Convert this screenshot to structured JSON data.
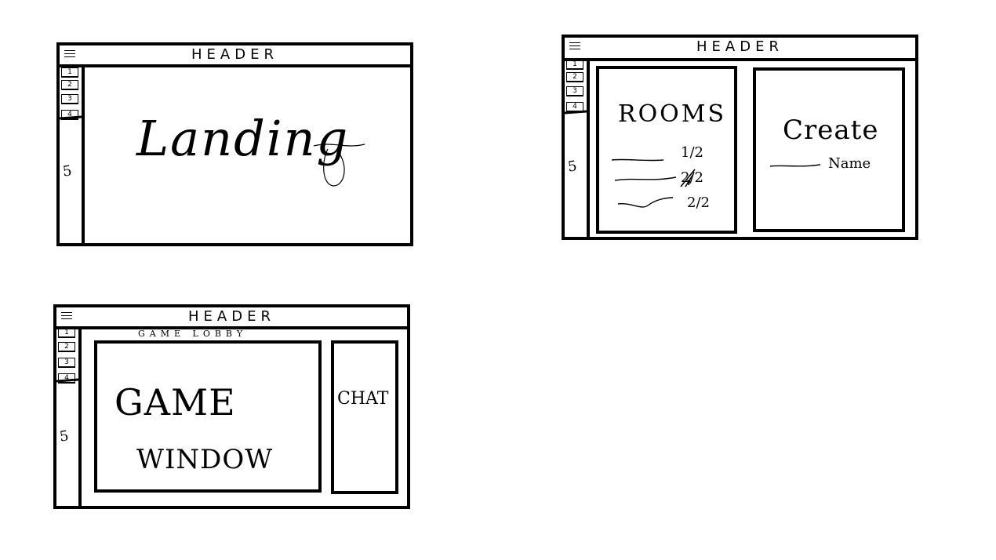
{
  "wireframes": {
    "landing": {
      "header": "HEADER",
      "sidebar_items": [
        "1",
        "2",
        "3",
        "4"
      ],
      "sidebar_footer": "5",
      "content_label": "Landing"
    },
    "rooms": {
      "header": "HEADER",
      "sidebar_items": [
        "1",
        "2",
        "3",
        "4"
      ],
      "sidebar_footer": "5",
      "rooms_title": "ROOMS",
      "room_counts": [
        "1/2",
        "2/2",
        "2/2"
      ],
      "create_title": "Create",
      "create_field_label": "Name"
    },
    "game": {
      "header": "HEADER",
      "subtitle": "GAME LOBBY",
      "sidebar_items": [
        "1",
        "2",
        "3",
        "4"
      ],
      "sidebar_footer": "5",
      "game_window_line1": "GAME",
      "game_window_line2": "WINDOW",
      "chat_label": "CHAT"
    }
  }
}
